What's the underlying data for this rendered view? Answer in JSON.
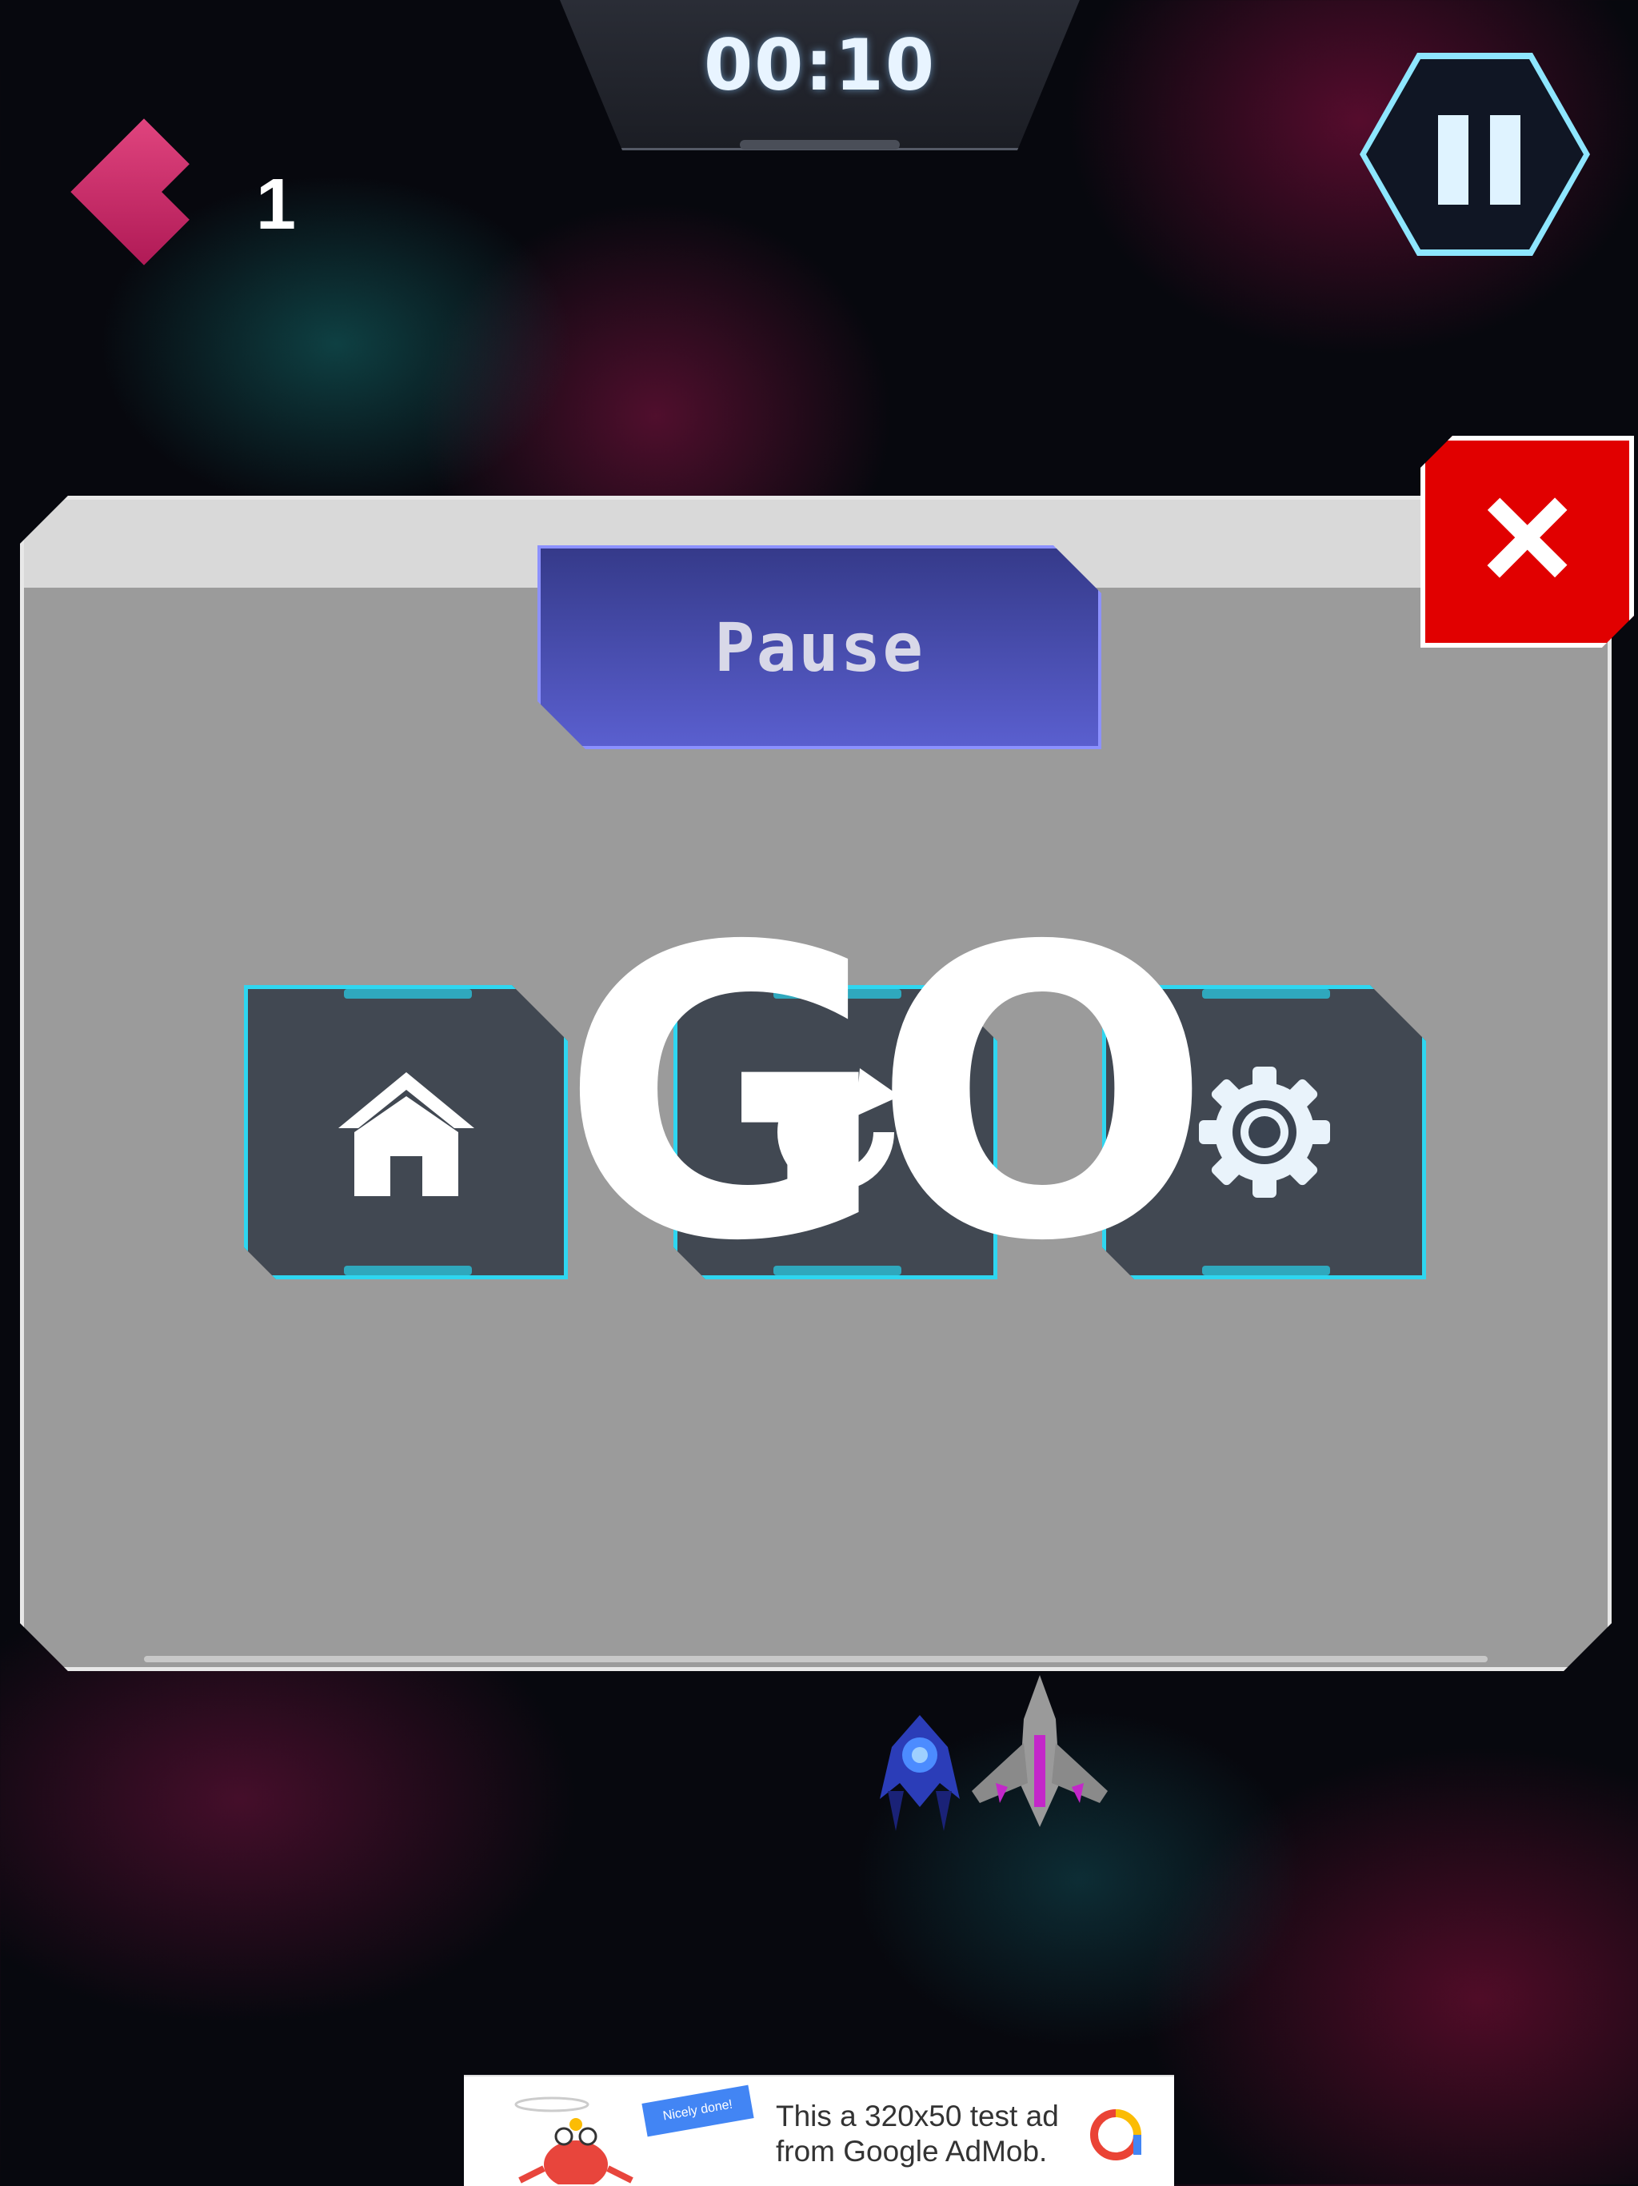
{
  "hud": {
    "timer": "00:10",
    "lives": "1",
    "pause_icon": "pause-icon",
    "heart_icon": "heart-icon"
  },
  "pause_dialog": {
    "title": "Pause",
    "close_icon": "close-icon",
    "close_label": "×",
    "buttons": [
      {
        "id": "home",
        "icon": "home-icon"
      },
      {
        "id": "restart",
        "icon": "restart-icon"
      },
      {
        "id": "settings",
        "icon": "gear-icon"
      }
    ]
  },
  "overlay": {
    "go_text": "GO"
  },
  "ad": {
    "text_line1": "This a 320x50 test ad",
    "text_line2": "from Google AdMob.",
    "ribbon_text": "Nicely done!"
  },
  "colors": {
    "accent_cyan": "#2fd6f0",
    "title_tab": "#4a4fbf",
    "close_red": "#e10000",
    "heart_pink": "#d42c6a"
  }
}
